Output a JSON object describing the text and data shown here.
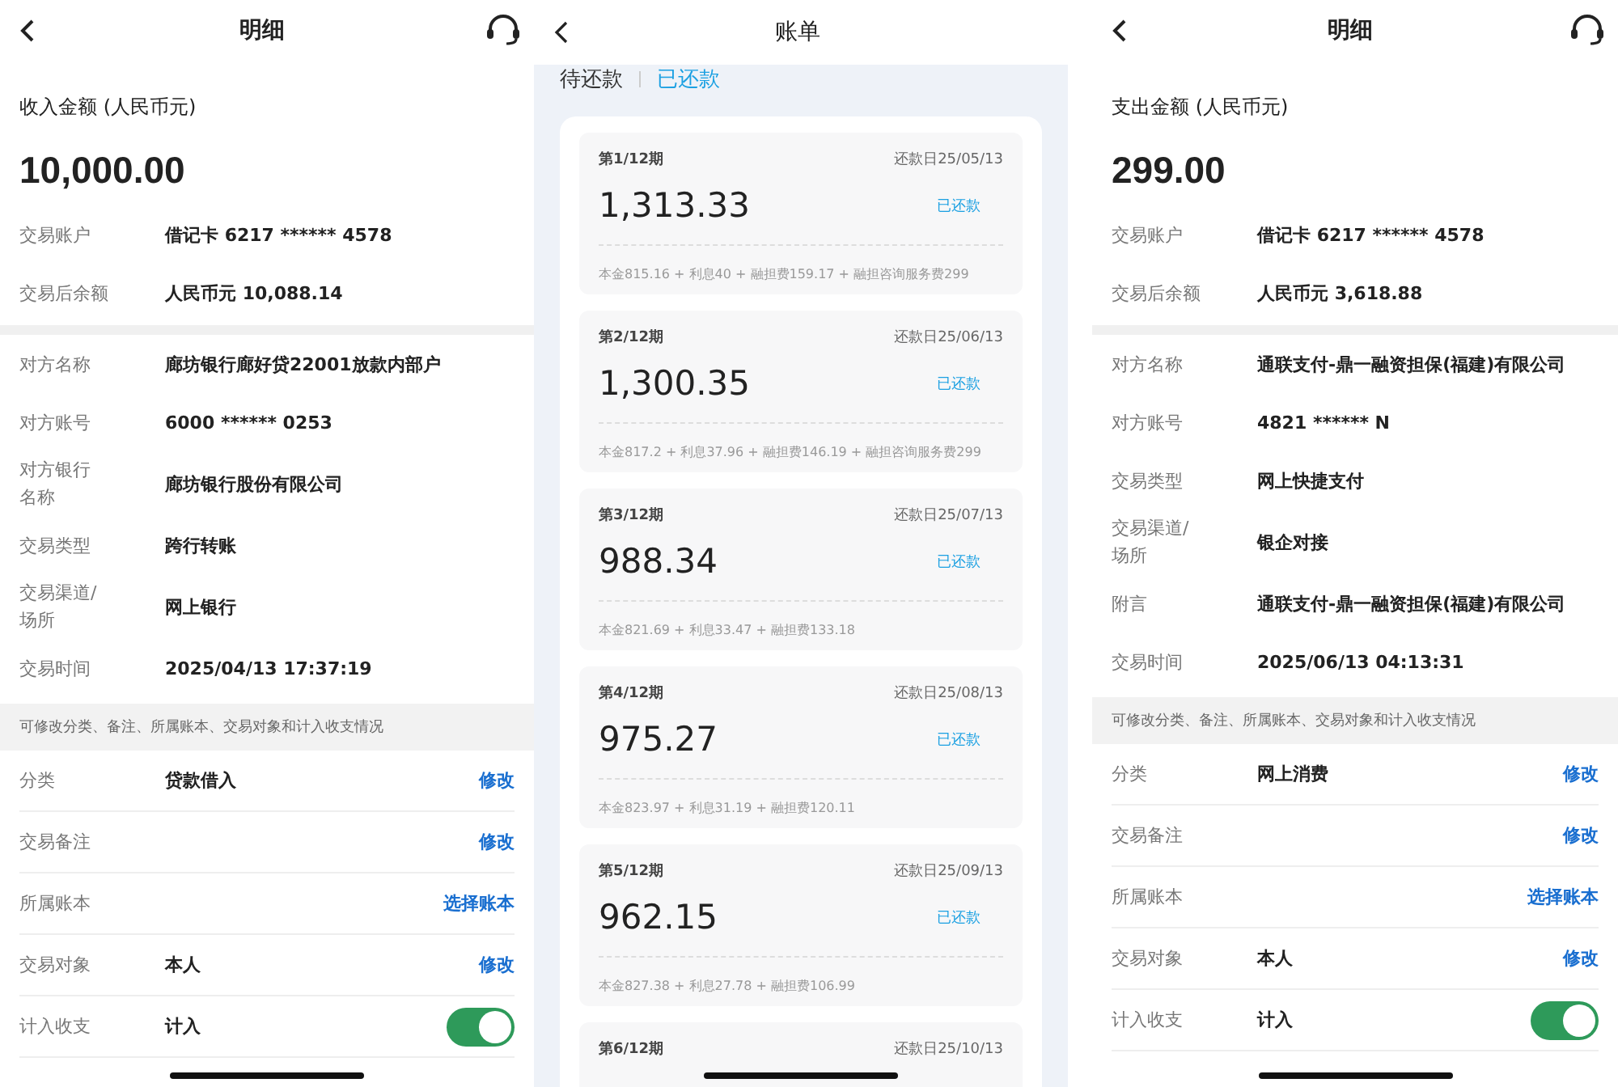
{
  "panels": [
    {
      "kind": "detail",
      "title": "明细",
      "amount_label": "收入金额 (人民币元)",
      "amount": "10,000.00",
      "summary_rows": [
        {
          "label": "交易账户",
          "value": "借记卡 6217 ****** 4578"
        },
        {
          "label": "交易后余额",
          "value": "人民币元 10,088.14"
        }
      ],
      "party_rows": [
        {
          "label": "对方名称",
          "value": "廊坊银行廊好贷22001放款内部户"
        },
        {
          "label": "对方账号",
          "value": "6000 ****** 0253"
        },
        {
          "label": "对方银行名称",
          "value": "廊坊银行股份有限公司"
        },
        {
          "label": "交易类型",
          "value": "跨行转账"
        },
        {
          "label": "交易渠道/场所",
          "value": "网上银行"
        },
        {
          "label": "交易时间",
          "value": "2025/04/13 17:37:19"
        }
      ],
      "note": "可修改分类、备注、所属账本、交易对象和计入收支情况",
      "edit_rows": [
        {
          "kind": "link",
          "label": "分类",
          "value": "贷款借入",
          "action": "修改"
        },
        {
          "kind": "link",
          "label": "交易备注",
          "action": "修改"
        },
        {
          "kind": "link",
          "label": "所属账本",
          "action": "选择账本"
        },
        {
          "kind": "link",
          "label": "交易对象",
          "value": "本人",
          "action": "修改"
        },
        {
          "kind": "toggle",
          "label": "计入收支",
          "value": "计入",
          "on": true
        }
      ]
    },
    {
      "kind": "bill",
      "title": "账单",
      "tabs": [
        {
          "label": "待还款",
          "selected": false
        },
        {
          "label": "已还款",
          "selected": true
        }
      ],
      "installments": [
        {
          "period": "第1/12期",
          "due": "还款日25/05/13",
          "amount": "1,313.33",
          "status": "已还款",
          "breakdown": "本金815.16 + 利息40 + 融担费159.17 + 融担咨询服务费299"
        },
        {
          "period": "第2/12期",
          "due": "还款日25/06/13",
          "amount": "1,300.35",
          "status": "已还款",
          "breakdown": "本金817.2 + 利息37.96 + 融担费146.19 + 融担咨询服务费299"
        },
        {
          "period": "第3/12期",
          "due": "还款日25/07/13",
          "amount": "988.34",
          "status": "已还款",
          "breakdown": "本金821.69 + 利息33.47 + 融担费133.18"
        },
        {
          "period": "第4/12期",
          "due": "还款日25/08/13",
          "amount": "975.27",
          "status": "已还款",
          "breakdown": "本金823.97 + 利息31.19 + 融担费120.11"
        },
        {
          "period": "第5/12期",
          "due": "还款日25/09/13",
          "amount": "962.15",
          "status": "已还款",
          "breakdown": "本金827.38 + 利息27.78 + 融担费106.99"
        },
        {
          "period": "第6/12期",
          "due": "还款日25/10/13"
        }
      ]
    },
    {
      "kind": "detail",
      "title": "明细",
      "amount_label": "支出金额 (人民币元)",
      "amount": "299.00",
      "summary_rows": [
        {
          "label": "交易账户",
          "value": "借记卡 6217 ****** 4578"
        },
        {
          "label": "交易后余额",
          "value": "人民币元 3,618.88"
        }
      ],
      "party_rows": [
        {
          "label": "对方名称",
          "value": "通联支付-鼎一融资担保(福建)有限公司"
        },
        {
          "label": "对方账号",
          "value": "4821 ****** N"
        },
        {
          "label": "交易类型",
          "value": "网上快捷支付"
        },
        {
          "label": "交易渠道/场所",
          "value": "银企对接"
        },
        {
          "label": "附言",
          "value": "通联支付-鼎一融资担保(福建)有限公司"
        },
        {
          "label": "交易时间",
          "value": "2025/06/13 04:13:31"
        }
      ],
      "note": "可修改分类、备注、所属账本、交易对象和计入收支情况",
      "edit_rows": [
        {
          "kind": "link",
          "label": "分类",
          "value": "网上消费",
          "action": "修改"
        },
        {
          "kind": "link",
          "label": "交易备注",
          "action": "修改"
        },
        {
          "kind": "link",
          "label": "所属账本",
          "action": "选择账本"
        },
        {
          "kind": "link",
          "label": "交易对象",
          "value": "本人",
          "action": "修改"
        },
        {
          "kind": "toggle",
          "label": "计入收支",
          "value": "计入",
          "on": true
        }
      ]
    }
  ]
}
